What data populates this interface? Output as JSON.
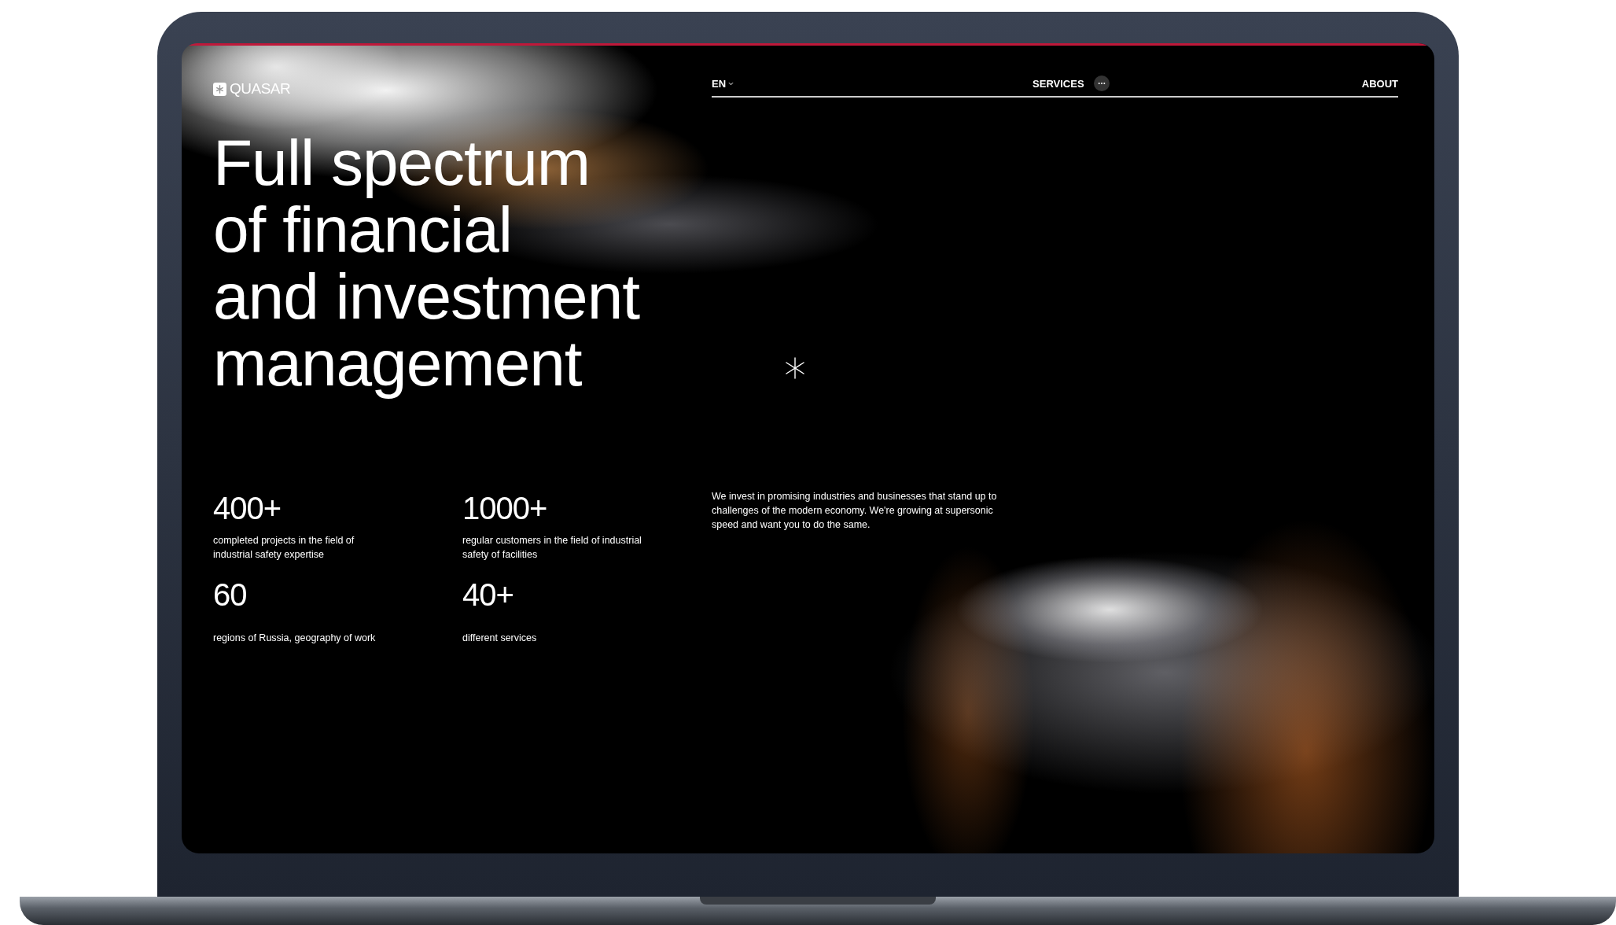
{
  "logo": {
    "text": "QUASAR"
  },
  "nav": {
    "language": "EN",
    "items": [
      {
        "label": "SERVICES",
        "kind": "more"
      },
      {
        "label": "ABOUT",
        "kind": "plain"
      }
    ]
  },
  "hero": {
    "title_lines": [
      "Full spectrum",
      "of financial",
      "and investment",
      "management"
    ]
  },
  "stats": [
    {
      "value": "400+",
      "caption": "completed projects in the field of industrial safety expertise"
    },
    {
      "value": "1000+",
      "caption": "regular customers in the field of industrial safety of facilities"
    },
    {
      "value": "60",
      "caption": "regions of Russia, geography of work"
    },
    {
      "value": "40+",
      "caption": "different services"
    }
  ],
  "intro": "We invest in promising industries and businesses that stand up to challenges of the modern economy. We're growing at supersonic speed and want you to do the same."
}
